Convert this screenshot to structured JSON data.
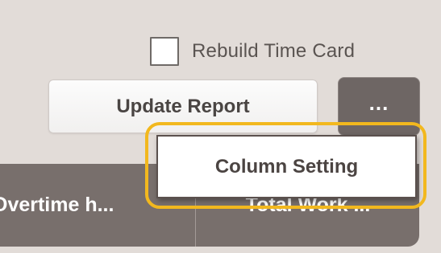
{
  "toolbar": {
    "rebuild_label": "Rebuild Time Card",
    "rebuild_checked": false,
    "update_report_label": "Update Report",
    "more_label": "..."
  },
  "dropdown": {
    "items": [
      {
        "label": "Column Setting"
      }
    ]
  },
  "table": {
    "columns": [
      {
        "label": "Overtime h..."
      },
      {
        "label": "Total Work ..."
      }
    ]
  },
  "colors": {
    "background": "#e2dcd8",
    "header_bg": "#786f6c",
    "more_button_bg": "#6e6664",
    "highlight": "#f2b81e"
  },
  "icons": {
    "more": "more-horizontal-icon",
    "checkbox": "checkbox-unchecked"
  }
}
